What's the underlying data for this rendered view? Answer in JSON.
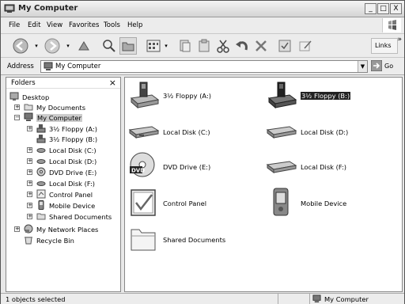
{
  "window": {
    "title": "My Computer",
    "minimize": "_",
    "maximize": "□",
    "close": "X"
  },
  "menu": [
    "File",
    "Edit",
    "View",
    "Favorites",
    "Tools",
    "Help"
  ],
  "toolbar": {
    "buttons": [
      "back-icon",
      "forward-icon",
      "up-icon",
      "search-icon",
      "folders-icon",
      "views-icon",
      "copy-to-icon",
      "move-to-icon",
      "cut-icon",
      "undo-icon",
      "delete-icon",
      "properties-icon",
      "rename-icon"
    ],
    "links_label": "Links",
    "links_chevron": "»"
  },
  "address": {
    "label": "Address",
    "value": "My Computer",
    "go_label": "Go"
  },
  "folders": {
    "title": "Folders",
    "close": "×",
    "tree": [
      {
        "label": "Desktop",
        "icon": "desktop-icon"
      },
      {
        "label": "My Documents",
        "icon": "folder-icon"
      },
      {
        "label": "My Computer",
        "icon": "computer-icon"
      },
      {
        "label": "3½ Floppy (A:)",
        "icon": "floppy-icon"
      },
      {
        "label": "3½ Floppy (B:)",
        "icon": "floppy-icon"
      },
      {
        "label": "Local Disk (C:)",
        "icon": "disk-icon"
      },
      {
        "label": "Local Disk (D:)",
        "icon": "disk-icon"
      },
      {
        "label": "DVD Drive (E:)",
        "icon": "dvd-icon"
      },
      {
        "label": "Local Disk (F:)",
        "icon": "disk-icon"
      },
      {
        "label": "Control Panel",
        "icon": "control-panel-icon"
      },
      {
        "label": "Mobile Device",
        "icon": "mobile-device-icon"
      },
      {
        "label": "Shared Documents",
        "icon": "folder-icon"
      },
      {
        "label": "My Network Places",
        "icon": "network-icon"
      },
      {
        "label": "Recycle Bin",
        "icon": "recycle-bin-icon"
      }
    ]
  },
  "items": [
    {
      "label": "3½ Floppy (A:)",
      "icon": "floppy-icon"
    },
    {
      "label": "3½ Floppy (B:)",
      "icon": "floppy-icon",
      "selected": true
    },
    {
      "label": "Local Disk (C:)",
      "icon": "disk-icon"
    },
    {
      "label": "Local Disk (D:)",
      "icon": "disk-icon"
    },
    {
      "label": "DVD Drive (E:)",
      "icon": "dvd-icon"
    },
    {
      "label": "Local Disk (F:)",
      "icon": "disk-icon"
    },
    {
      "label": "Control Panel",
      "icon": "control-panel-icon"
    },
    {
      "label": "Mobile Device",
      "icon": "mobile-device-icon"
    },
    {
      "label": "Shared Documents",
      "icon": "folder-icon"
    }
  ],
  "status": {
    "left": "1 objects selected",
    "right": "My Computer"
  }
}
